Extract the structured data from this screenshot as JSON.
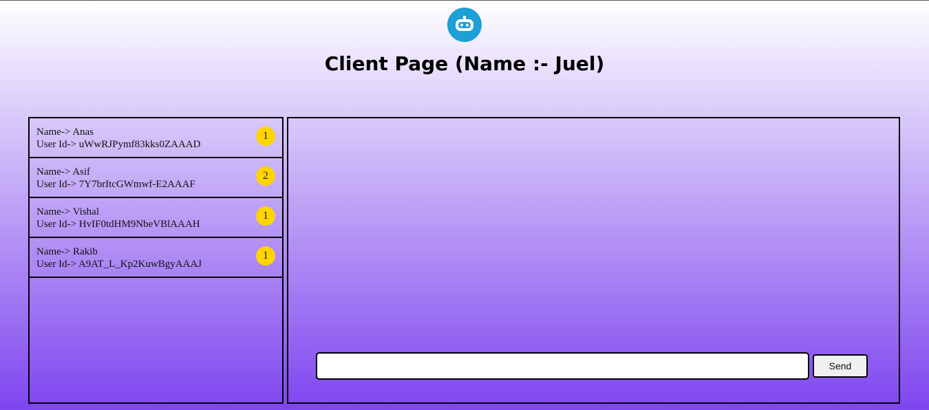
{
  "header": {
    "logo_icon": "robot-icon",
    "title": "Client Page (Name :- Juel)"
  },
  "users": [
    {
      "name_line": "Name-> Anas",
      "id_line": "User Id-> uWwRJPymf83kks0ZAAAD",
      "unread": "1"
    },
    {
      "name_line": "Name-> Asif",
      "id_line": "User Id-> 7Y7brItcGWmwf-E2AAAF",
      "unread": "2"
    },
    {
      "name_line": "Name-> Vishal",
      "id_line": "User Id-> HvIF0tdHM9NbeVBlAAAH",
      "unread": "1"
    },
    {
      "name_line": "Name-> Rakib",
      "id_line": "User Id-> A9AT_L_Kp2KuwBgyAAAJ",
      "unread": "1"
    }
  ],
  "composer": {
    "input_value": "",
    "send_label": "Send"
  },
  "colors": {
    "badge": "#ffd400",
    "logo": "#1e9fd6",
    "gradient_top": "#ffffff",
    "gradient_bottom": "#7e45f0"
  }
}
